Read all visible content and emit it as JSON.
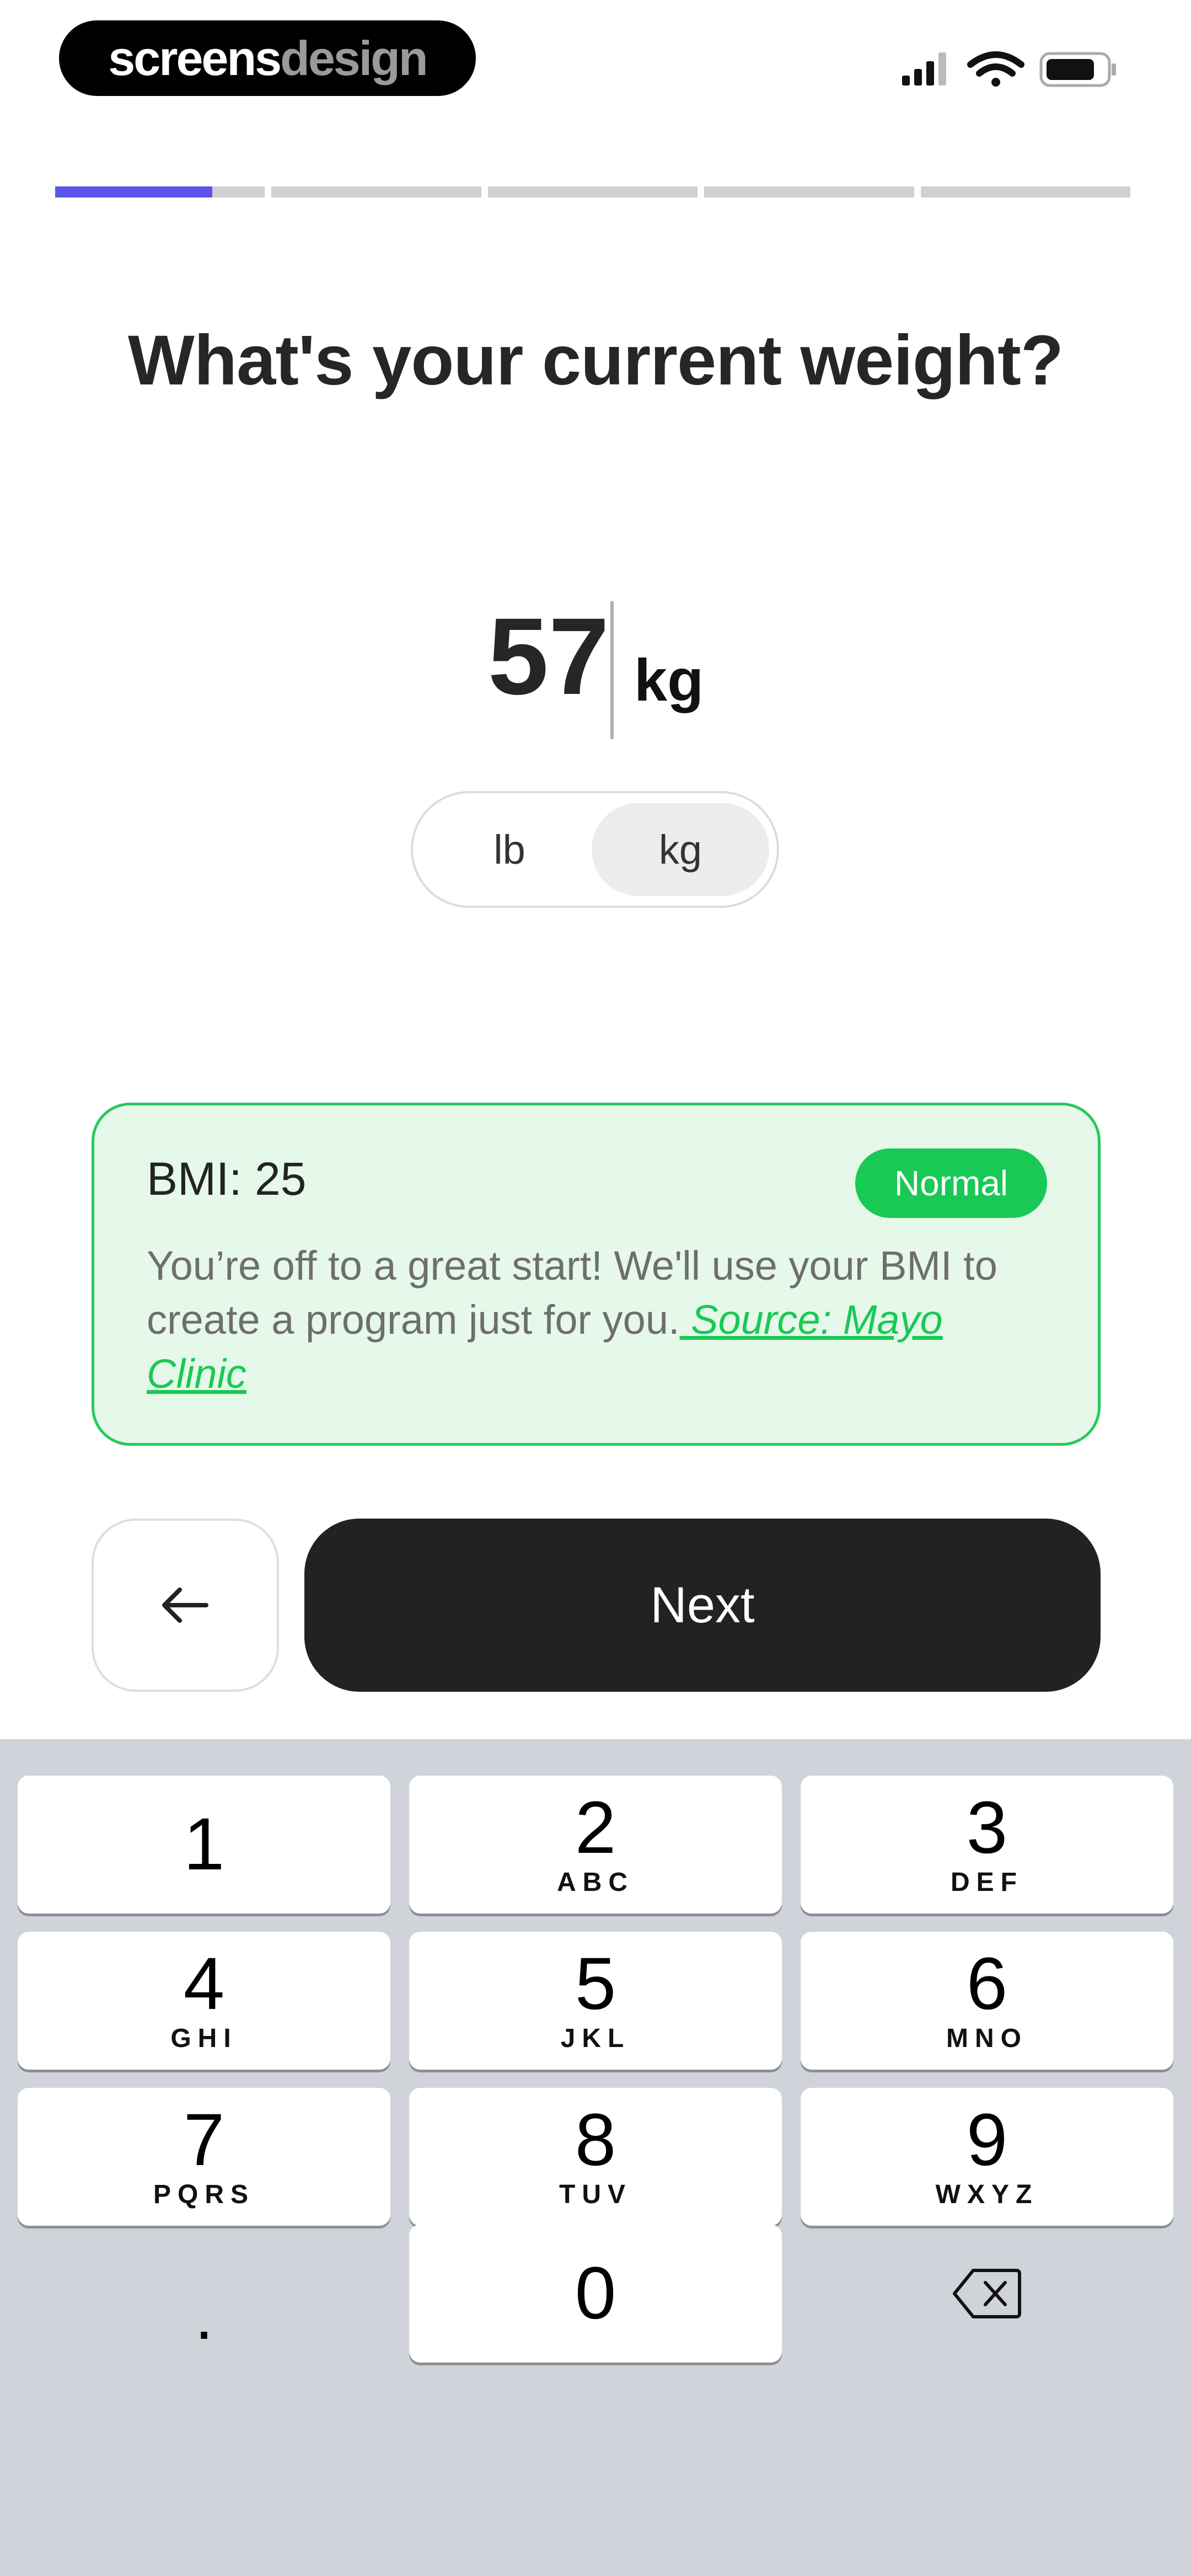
{
  "status_bar": {
    "brand_part1": "screens",
    "brand_part2": "design",
    "icons": [
      "cellular-signal-icon",
      "wifi-icon",
      "battery-icon"
    ]
  },
  "progress": {
    "segments": 5,
    "current_segment": 1,
    "current_segment_fill": 0.75,
    "accent_color": "#5b54e8"
  },
  "header": {
    "title": "What's your current weight?"
  },
  "weight": {
    "value": "57",
    "unit": "kg"
  },
  "unit_toggle": {
    "options": [
      "lb",
      "kg"
    ],
    "selected": "kg"
  },
  "bmi_card": {
    "label": "BMI: 25",
    "badge": "Normal",
    "text": "You’re off to a great start! We'll use your BMI to create a program just for you.",
    "source_link": " Source: Mayo Clinic",
    "accent_color": "#19c955"
  },
  "actions": {
    "back_icon": "arrow-left-icon",
    "next_label": "Next"
  },
  "keyboard": {
    "keys": [
      {
        "digit": "1",
        "letters": ""
      },
      {
        "digit": "2",
        "letters": "ABC"
      },
      {
        "digit": "3",
        "letters": "DEF"
      },
      {
        "digit": "4",
        "letters": "GHI"
      },
      {
        "digit": "5",
        "letters": "JKL"
      },
      {
        "digit": "6",
        "letters": "MNO"
      },
      {
        "digit": "7",
        "letters": "PQRS"
      },
      {
        "digit": "8",
        "letters": "TUV"
      },
      {
        "digit": "9",
        "letters": "WXYZ"
      },
      {
        "digit": "0",
        "letters": ""
      }
    ],
    "decimal_key": ".",
    "delete_icon": "backspace-icon"
  }
}
